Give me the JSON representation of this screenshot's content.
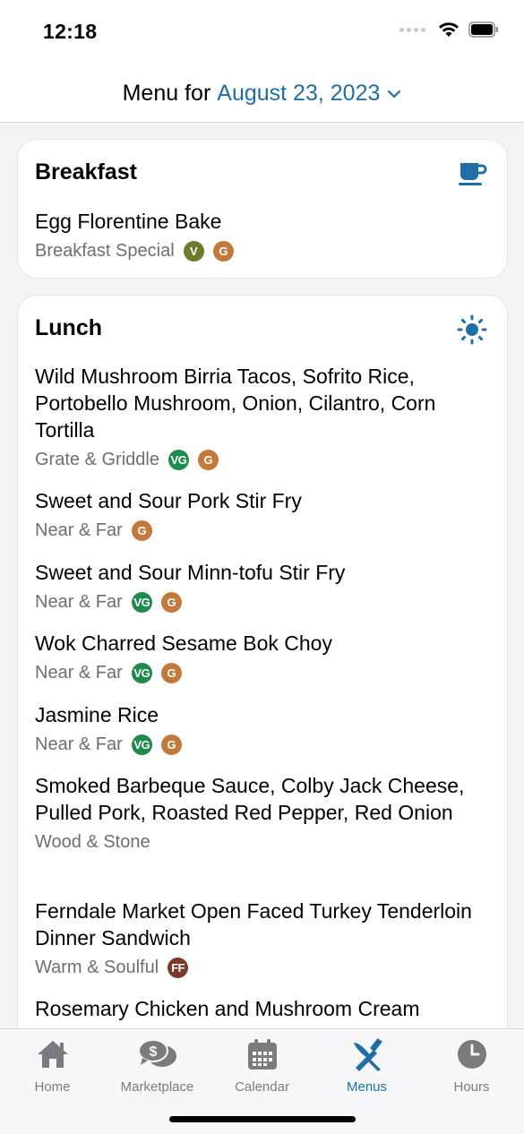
{
  "status": {
    "time": "12:18"
  },
  "header": {
    "prefix": "Menu for",
    "date": "August 23, 2023"
  },
  "colors": {
    "accent": "#1f6fa7",
    "vegetarian": "#6e7a2e",
    "vegan": "#1e8a4c",
    "gluten": "#c2793a",
    "ff": "#7a3a2a"
  },
  "breakfast": {
    "title": "Breakfast",
    "icon": "coffee-cup-icon",
    "items": [
      {
        "name": "Egg Florentine Bake",
        "station": "Breakfast Special",
        "badges": [
          "V",
          "G"
        ]
      }
    ]
  },
  "lunch": {
    "title": "Lunch",
    "icon": "sun-icon",
    "items": [
      {
        "name": "Wild Mushroom Birria Tacos, Sofrito Rice, Portobello Mushroom, Onion, Cilantro, Corn Tortilla",
        "station": "Grate & Griddle",
        "badges": [
          "VG",
          "G"
        ]
      },
      {
        "name": "Sweet and Sour Pork Stir Fry",
        "station": "Near & Far",
        "badges": [
          "G"
        ]
      },
      {
        "name": "Sweet and Sour Minn-tofu Stir Fry",
        "station": "Near & Far",
        "badges": [
          "VG",
          "G"
        ]
      },
      {
        "name": "Wok Charred Sesame Bok Choy",
        "station": "Near & Far",
        "badges": [
          "VG",
          "G"
        ]
      },
      {
        "name": "Jasmine Rice",
        "station": "Near & Far",
        "badges": [
          "VG",
          "G"
        ]
      },
      {
        "name": "Smoked Barbeque Sauce, Colby Jack Cheese, Pulled Pork, Roasted Red Pepper, Red Onion",
        "station": "Wood & Stone",
        "badges": []
      },
      {
        "name": "Ferndale Market Open Faced Turkey Tenderloin Dinner Sandwich",
        "station": "Warm & Soulful",
        "badges": [
          "FF"
        ]
      },
      {
        "name": "Rosemary Chicken and Mushroom Cream",
        "station": "",
        "badges": []
      }
    ]
  },
  "tabs": [
    {
      "label": "Home",
      "icon": "home-icon",
      "active": false
    },
    {
      "label": "Marketplace",
      "icon": "marketplace-chat-icon",
      "active": false
    },
    {
      "label": "Calendar",
      "icon": "calendar-icon",
      "active": false
    },
    {
      "label": "Menus",
      "icon": "utensils-icon",
      "active": true
    },
    {
      "label": "Hours",
      "icon": "clock-icon",
      "active": false
    }
  ]
}
